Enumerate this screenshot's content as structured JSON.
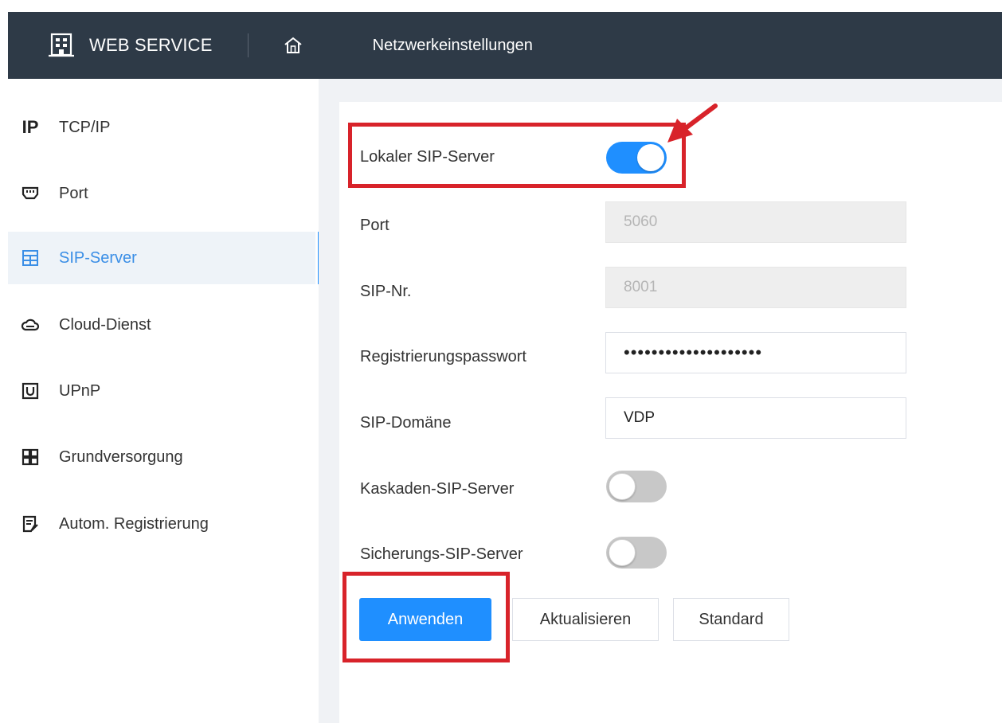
{
  "header": {
    "app_name": "WEB SERVICE",
    "page_title": "Netzwerkeinstellungen",
    "icons": {
      "brand": "building-icon",
      "home": "home-icon"
    }
  },
  "sidebar": {
    "items": [
      {
        "label": "TCP/IP",
        "icon_text": "IP",
        "icon": "ip-icon",
        "active": false
      },
      {
        "label": "Port",
        "icon": "port-icon",
        "active": false
      },
      {
        "label": "SIP-Server",
        "icon": "sip-server-icon",
        "active": true
      },
      {
        "label": "Cloud-Dienst",
        "icon": "cloud-icon",
        "active": false
      },
      {
        "label": "UPnP",
        "icon": "upnp-icon",
        "active": false
      },
      {
        "label": "Grundversorgung",
        "icon": "grid-icon",
        "active": false
      },
      {
        "label": "Autom. Registrierung",
        "icon": "register-icon",
        "active": false
      }
    ]
  },
  "form": {
    "local_sip_server": {
      "label": "Lokaler SIP-Server",
      "enabled": true
    },
    "port": {
      "label": "Port",
      "value": "5060"
    },
    "sip_nr": {
      "label": "SIP-Nr.",
      "value": "8001"
    },
    "password": {
      "label": "Registrierungspasswort",
      "value": "••••••••••••••••••••"
    },
    "sip_domain": {
      "label": "SIP-Domäne",
      "value": "VDP"
    },
    "cascade_sip_server": {
      "label": "Kaskaden-SIP-Server",
      "enabled": false
    },
    "backup_sip_server": {
      "label": "Sicherungs-SIP-Server",
      "enabled": false
    }
  },
  "buttons": {
    "apply": "Anwenden",
    "refresh": "Aktualisieren",
    "default": "Standard"
  },
  "colors": {
    "header_bg": "#2e3a47",
    "accent": "#1f8fff",
    "highlight": "#d8232a",
    "toggle_off": "#c8c8c8"
  }
}
